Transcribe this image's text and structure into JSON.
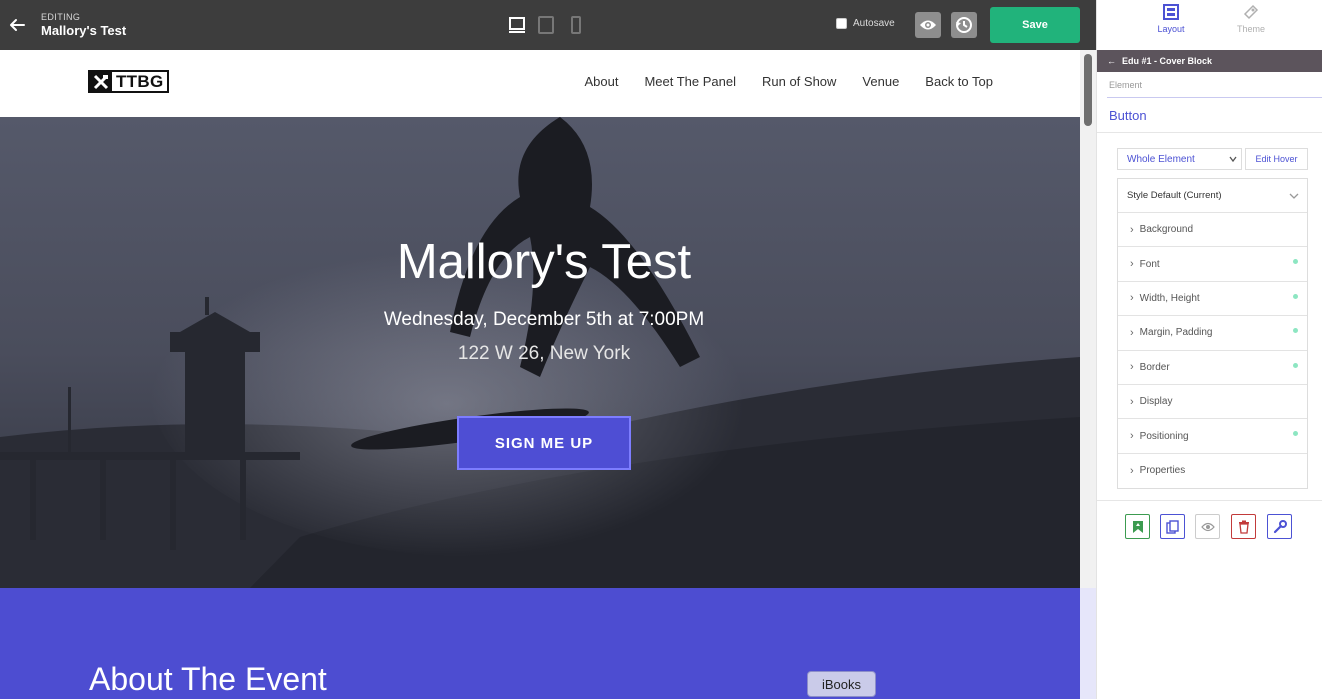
{
  "editor": {
    "edit_label": "EDITING",
    "page_title": "Mallory's Test",
    "autosave_label": "Autosave",
    "save_label": "Save",
    "device_icons": [
      "desktop-icon",
      "tablet-icon",
      "mobile-icon"
    ]
  },
  "site": {
    "logo_text": "TTBG",
    "nav": [
      "About",
      "Meet The Panel",
      "Run of Show",
      "Venue",
      "Back to Top"
    ],
    "hero": {
      "title": "Mallory's Test",
      "date": "Wednesday, December 5th at 7:00PM",
      "address": "122 W 26, New York",
      "cta": "SIGN ME UP"
    },
    "about_title": "About The Event"
  },
  "panel": {
    "tabs": [
      {
        "label": "Layout",
        "active": true
      },
      {
        "label": "Theme",
        "active": false
      }
    ],
    "breadcrumb": "Edu #1 - Cover Block",
    "element_label": "Element",
    "element_name": "Button",
    "scope_value": "Whole Element",
    "edit_hover_label": "Edit Hover",
    "style_header": "Style Default (Current)",
    "style_rows": [
      {
        "label": "Background",
        "modified": false
      },
      {
        "label": "Font",
        "modified": true
      },
      {
        "label": "Width, Height",
        "modified": true
      },
      {
        "label": "Margin, Padding",
        "modified": true
      },
      {
        "label": "Border",
        "modified": true
      },
      {
        "label": "Display",
        "modified": false
      },
      {
        "label": "Positioning",
        "modified": true
      },
      {
        "label": "Properties",
        "modified": false
      }
    ],
    "actions": [
      "bookmark-icon",
      "duplicate-icon",
      "eye-icon",
      "trash-icon",
      "wrench-icon"
    ]
  },
  "dock_tooltip": "iBooks",
  "colors": {
    "accent": "#4c52d4",
    "save_green": "#21b37b",
    "about_bg": "#4d4dd1",
    "topbar": "#3d3d3d",
    "breadcrumb_bg": "#5c545c",
    "modified_dot": "#8de6c2"
  }
}
